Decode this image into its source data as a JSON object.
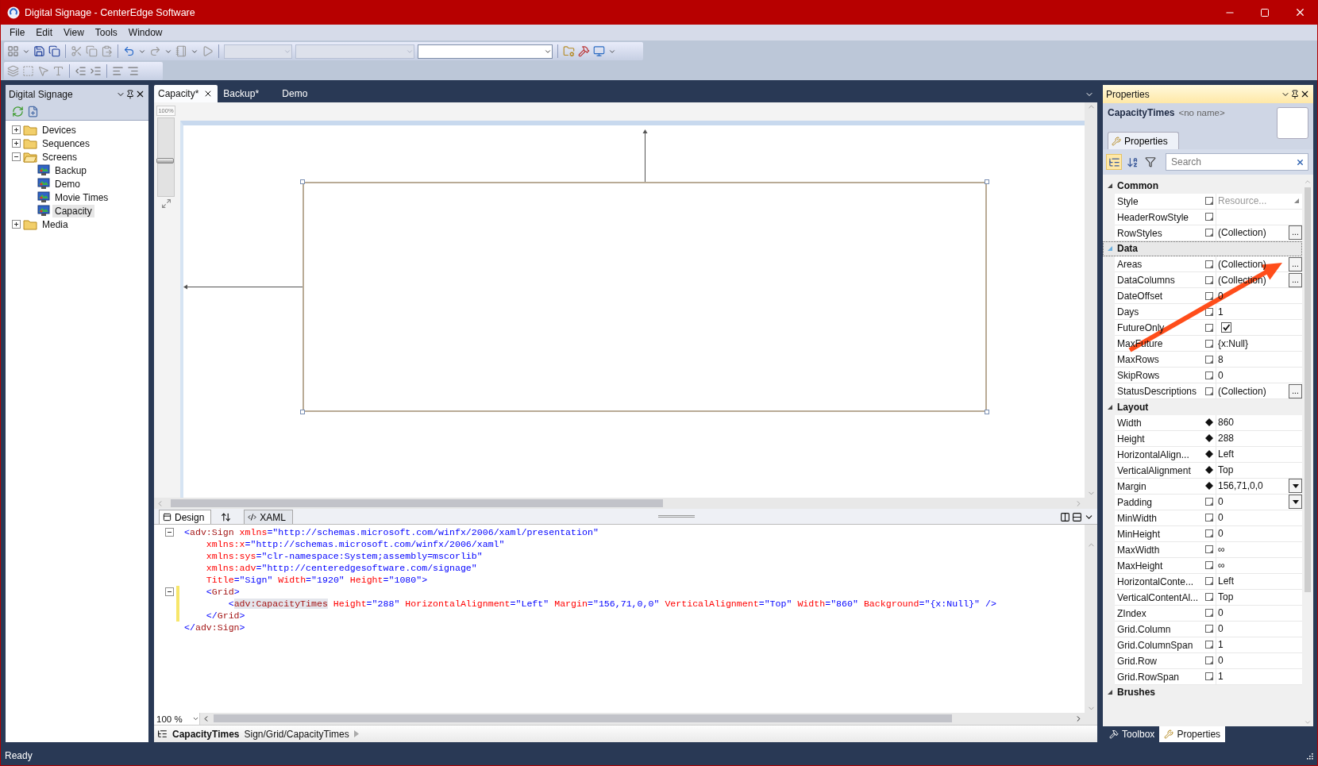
{
  "window": {
    "title": "Digital Signage - CenterEdge Software"
  },
  "menu": [
    "File",
    "Edit",
    "View",
    "Tools",
    "Window"
  ],
  "toolbar": {
    "combos": [
      {
        "disabled": true
      },
      {
        "disabled": true
      },
      {
        "disabled": false
      }
    ]
  },
  "left_panel": {
    "title": "Digital Signage",
    "tree": [
      {
        "label": "Devices",
        "kind": "folder",
        "expanded": false,
        "selected": false
      },
      {
        "label": "Sequences",
        "kind": "folder",
        "expanded": false,
        "selected": false
      },
      {
        "label": "Screens",
        "kind": "folder",
        "expanded": true,
        "selected": false,
        "children": [
          {
            "label": "Backup",
            "kind": "screen",
            "selected": false
          },
          {
            "label": "Demo",
            "kind": "screen",
            "selected": false
          },
          {
            "label": "Movie Times",
            "kind": "screen",
            "selected": false
          },
          {
            "label": "Capacity",
            "kind": "screen",
            "selected": true
          }
        ]
      },
      {
        "label": "Media",
        "kind": "folder",
        "expanded": false,
        "selected": false
      }
    ]
  },
  "tabs": [
    {
      "label": "Capacity*",
      "selected": true
    },
    {
      "label": "Backup*",
      "selected": false
    },
    {
      "label": "Demo",
      "selected": false
    }
  ],
  "designer": {
    "zoom_label": "100%",
    "zoom_slider": {
      "level": 0.45
    }
  },
  "view_tabs": [
    {
      "label": "Design",
      "selected": true
    },
    {
      "label": "XAML",
      "selected": false
    }
  ],
  "code": [
    {
      "fold": true,
      "changed": false,
      "tokens": [
        {
          "kind": "punct",
          "text": "<"
        },
        {
          "kind": "tag",
          "text": "adv:Sign"
        },
        {
          "kind": "attr",
          "text": " xmlns"
        },
        {
          "kind": "punct",
          "text": "="
        },
        {
          "kind": "value",
          "text": "\"http://schemas.microsoft.com/winfx/2006/xaml/presentation\""
        }
      ]
    },
    {
      "fold": false,
      "changed": false,
      "tokens": [
        {
          "kind": "attr",
          "text": "    xmlns:x"
        },
        {
          "kind": "punct",
          "text": "="
        },
        {
          "kind": "value",
          "text": "\"http://schemas.microsoft.com/winfx/2006/xaml\""
        }
      ]
    },
    {
      "fold": false,
      "changed": false,
      "tokens": [
        {
          "kind": "attr",
          "text": "    xmlns:sys"
        },
        {
          "kind": "punct",
          "text": "="
        },
        {
          "kind": "value",
          "text": "\"clr-namespace:System;assembly=mscorlib\""
        }
      ]
    },
    {
      "fold": false,
      "changed": false,
      "tokens": [
        {
          "kind": "attr",
          "text": "    xmlns:adv"
        },
        {
          "kind": "punct",
          "text": "="
        },
        {
          "kind": "value",
          "text": "\"http://centeredgesoftware.com/signage\""
        }
      ]
    },
    {
      "fold": false,
      "changed": false,
      "tokens": [
        {
          "kind": "attr",
          "text": "    Title"
        },
        {
          "kind": "punct",
          "text": "="
        },
        {
          "kind": "value",
          "text": "\"Sign\""
        },
        {
          "kind": "attr",
          "text": " Width"
        },
        {
          "kind": "punct",
          "text": "="
        },
        {
          "kind": "value",
          "text": "\"1920\""
        },
        {
          "kind": "attr",
          "text": " Height"
        },
        {
          "kind": "punct",
          "text": "="
        },
        {
          "kind": "value",
          "text": "\"1080\""
        },
        {
          "kind": "punct",
          "text": ">"
        }
      ]
    },
    {
      "fold": true,
      "changed": true,
      "tokens": [
        {
          "kind": "punct",
          "text": "    <"
        },
        {
          "kind": "tag",
          "text": "Grid"
        },
        {
          "kind": "punct",
          "text": ">"
        }
      ]
    },
    {
      "fold": false,
      "changed": true,
      "tokens": [
        {
          "kind": "punct",
          "text": "        <"
        },
        {
          "kind": "tag-selected",
          "text": "adv:CapacityTimes"
        },
        {
          "kind": "attr",
          "text": " Height"
        },
        {
          "kind": "punct",
          "text": "="
        },
        {
          "kind": "value",
          "text": "\"288\""
        },
        {
          "kind": "attr",
          "text": " HorizontalAlignment"
        },
        {
          "kind": "punct",
          "text": "="
        },
        {
          "kind": "value",
          "text": "\"Left\""
        },
        {
          "kind": "attr",
          "text": " Margin"
        },
        {
          "kind": "punct",
          "text": "="
        },
        {
          "kind": "value",
          "text": "\"156,71,0,0\""
        },
        {
          "kind": "attr",
          "text": " VerticalAlignment"
        },
        {
          "kind": "punct",
          "text": "="
        },
        {
          "kind": "value",
          "text": "\"Top\""
        },
        {
          "kind": "attr",
          "text": " Width"
        },
        {
          "kind": "punct",
          "text": "="
        },
        {
          "kind": "value",
          "text": "\"860\""
        },
        {
          "kind": "attr",
          "text": " Background"
        },
        {
          "kind": "punct",
          "text": "="
        },
        {
          "kind": "value",
          "text": "\"{x:Null}\""
        },
        {
          "kind": "punct",
          "text": " />"
        }
      ]
    },
    {
      "fold": false,
      "changed": true,
      "tokens": [
        {
          "kind": "punct",
          "text": "    </"
        },
        {
          "kind": "tag",
          "text": "Grid"
        },
        {
          "kind": "punct",
          "text": ">"
        }
      ]
    },
    {
      "fold": false,
      "changed": false,
      "tokens": [
        {
          "kind": "punct",
          "text": "</"
        },
        {
          "kind": "tag",
          "text": "adv:Sign"
        },
        {
          "kind": "punct",
          "text": ">"
        }
      ]
    }
  ],
  "zoom": "100 %",
  "breadcrumb": {
    "element": "CapacityTimes",
    "path": "Sign/Grid/CapacityTimes"
  },
  "properties": {
    "title": "Properties",
    "element_type": "CapacityTimes",
    "element_name": "<no name>",
    "tab": "Properties",
    "search_placeholder": "Search",
    "sections": [
      {
        "title": "Common",
        "expanded": true,
        "selected": false,
        "rows": [
          {
            "name": "Style",
            "local": false,
            "kind": "resource",
            "value": "Resource..."
          },
          {
            "name": "HeaderRowStyle",
            "local": false,
            "kind": "text"
          },
          {
            "name": "RowStyles",
            "local": false,
            "kind": "ellipsis",
            "value": "(Collection)",
            "button": "..."
          }
        ]
      },
      {
        "title": "Data",
        "expanded": true,
        "selected": true,
        "rows": [
          {
            "name": "Areas",
            "local": false,
            "kind": "ellipsis",
            "value": "(Collection)",
            "button": "..."
          },
          {
            "name": "DataColumns",
            "local": false,
            "kind": "ellipsis",
            "value": "(Collection)",
            "button": "..."
          },
          {
            "name": "DateOffset",
            "local": false,
            "kind": "text",
            "value": "0"
          },
          {
            "name": "Days",
            "local": false,
            "kind": "text",
            "value": "1"
          },
          {
            "name": "FutureOnly",
            "local": false,
            "kind": "checkbox",
            "checked": true
          },
          {
            "name": "MaxFuture",
            "local": false,
            "kind": "text",
            "value": "{x:Null}"
          },
          {
            "name": "MaxRows",
            "local": false,
            "kind": "text",
            "value": "8"
          },
          {
            "name": "SkipRows",
            "local": false,
            "kind": "text",
            "value": "0"
          },
          {
            "name": "StatusDescriptions",
            "local": false,
            "kind": "ellipsis",
            "value": "(Collection)",
            "button": "..."
          }
        ]
      },
      {
        "title": "Layout",
        "expanded": true,
        "selected": false,
        "rows": [
          {
            "name": "Width",
            "local": true,
            "kind": "text",
            "value": "860"
          },
          {
            "name": "Height",
            "local": true,
            "kind": "text",
            "value": "288"
          },
          {
            "name": "HorizontalAlign...",
            "local": true,
            "kind": "text",
            "value": "Left"
          },
          {
            "name": "VerticalAlignment",
            "local": true,
            "kind": "text",
            "value": "Top"
          },
          {
            "name": "Margin",
            "local": true,
            "kind": "dropdown",
            "value": "156,71,0,0"
          },
          {
            "name": "Padding",
            "local": false,
            "kind": "dropdown",
            "value": "0"
          },
          {
            "name": "MinWidth",
            "local": false,
            "kind": "text",
            "value": "0"
          },
          {
            "name": "MinHeight",
            "local": false,
            "kind": "text",
            "value": "0"
          },
          {
            "name": "MaxWidth",
            "local": false,
            "kind": "text",
            "value": "∞"
          },
          {
            "name": "MaxHeight",
            "local": false,
            "kind": "text",
            "value": "∞"
          },
          {
            "name": "HorizontalConte...",
            "local": false,
            "kind": "text",
            "value": "Left"
          },
          {
            "name": "VerticalContentAl...",
            "local": false,
            "kind": "text",
            "value": "Top"
          },
          {
            "name": "ZIndex",
            "local": false,
            "kind": "text",
            "value": "0"
          },
          {
            "name": "Grid.Column",
            "local": false,
            "kind": "text",
            "value": "0"
          },
          {
            "name": "Grid.ColumnSpan",
            "local": false,
            "kind": "text",
            "value": "1"
          },
          {
            "name": "Grid.Row",
            "local": false,
            "kind": "text",
            "value": "0"
          },
          {
            "name": "Grid.RowSpan",
            "local": false,
            "kind": "text",
            "value": "1"
          }
        ]
      },
      {
        "title": "Brushes",
        "expanded": true,
        "selected": false
      }
    ]
  },
  "bottom_tabs": [
    {
      "label": "Toolbox",
      "kind": "toolbox",
      "selected": false
    },
    {
      "label": "Properties",
      "kind": "properties",
      "selected": true
    }
  ],
  "status": "Ready"
}
